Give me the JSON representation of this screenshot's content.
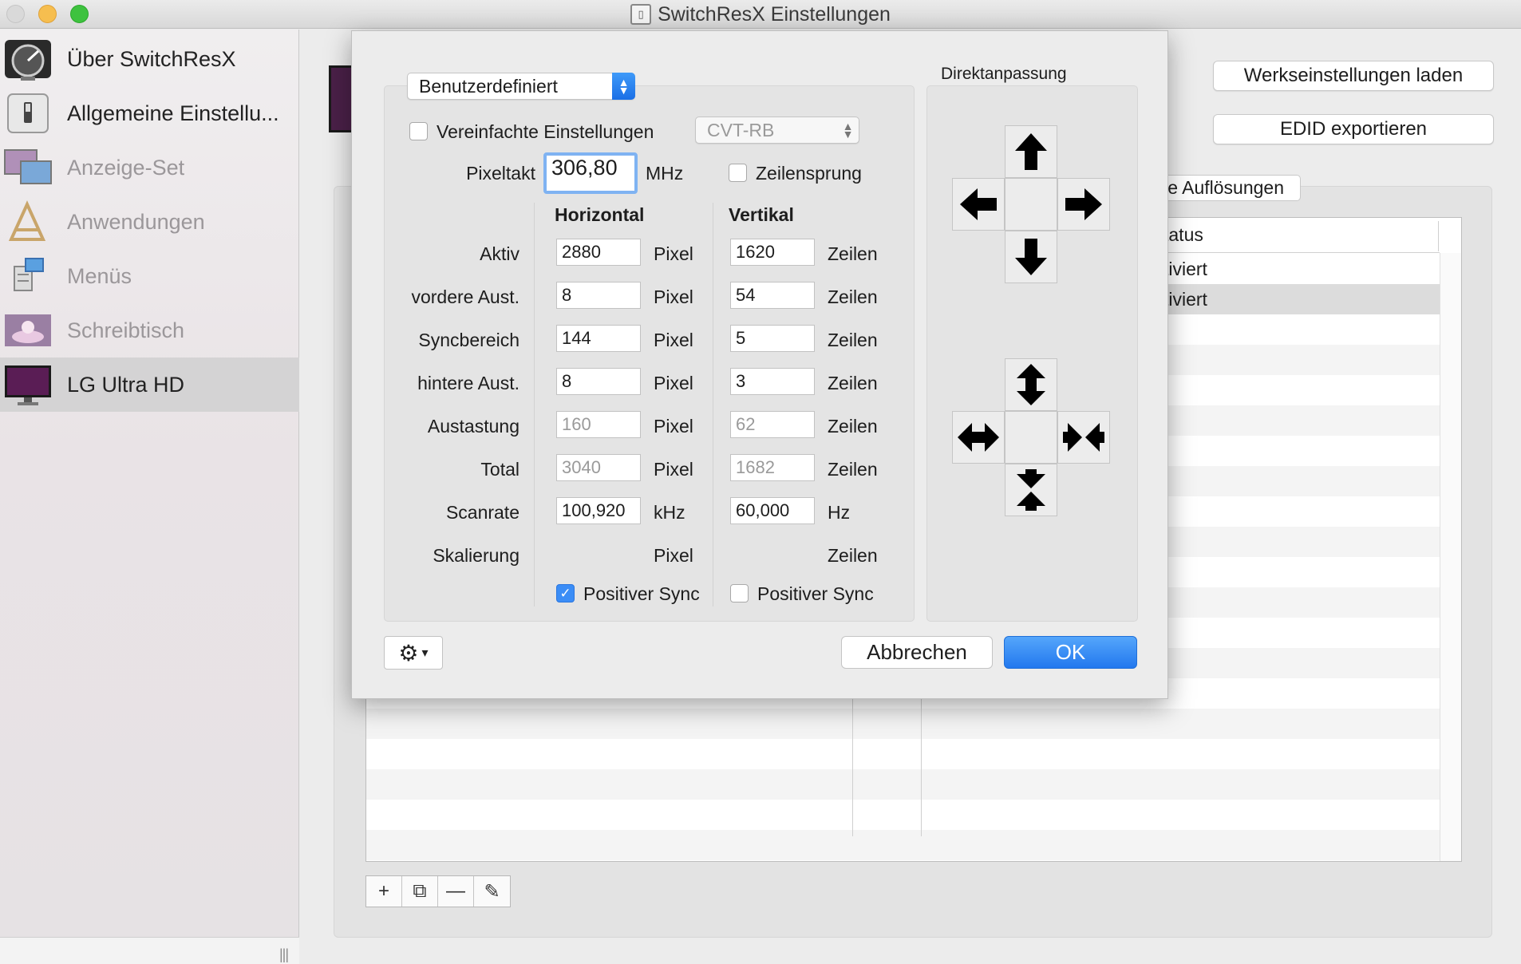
{
  "window": {
    "title": "SwitchResX Einstellungen"
  },
  "sidebar": {
    "items": [
      {
        "label": "Über SwitchResX",
        "enabled": true,
        "selected": false,
        "icon": "gauge-icon"
      },
      {
        "label": "Allgemeine Einstellu...",
        "enabled": true,
        "selected": false,
        "icon": "switch-icon"
      },
      {
        "label": "Anzeige-Set",
        "enabled": false,
        "selected": false,
        "icon": "displays-icon"
      },
      {
        "label": "Anwendungen",
        "enabled": false,
        "selected": false,
        "icon": "applications-icon"
      },
      {
        "label": "Menüs",
        "enabled": false,
        "selected": false,
        "icon": "menus-icon"
      },
      {
        "label": "Schreibtisch",
        "enabled": false,
        "selected": false,
        "icon": "desktop-icon"
      },
      {
        "label": "LG Ultra HD",
        "enabled": true,
        "selected": true,
        "icon": "monitor-icon"
      }
    ]
  },
  "main": {
    "factory_button": "Werkseinstellungen laden",
    "edid_button": "EDID exportieren",
    "tab_label": "e Auflösungen",
    "table": {
      "status_header": "tatus",
      "rows": [
        "tiviert",
        "tiviert"
      ]
    },
    "tools": {
      "add": "+",
      "duplicate": "⧉",
      "remove": "—",
      "edit": "✎"
    }
  },
  "dialog": {
    "preset": "Benutzerdefiniert",
    "simplified_label": "Vereinfachte Einstellungen",
    "simplified_checked": false,
    "timing_mode": "CVT-RB",
    "pixelclock_label": "Pixeltakt",
    "pixelclock_value": "306,80",
    "pixelclock_unit": "MHz",
    "interlace_label": "Zeilensprung",
    "interlace_checked": false,
    "col_horizontal": "Horizontal",
    "col_vertical": "Vertikal",
    "rows": [
      {
        "label": "Aktiv",
        "h": "2880",
        "h_unit": "Pixel",
        "v": "1620",
        "v_unit": "Zeilen",
        "editable": true
      },
      {
        "label": "vordere Aust.",
        "h": "8",
        "h_unit": "Pixel",
        "v": "54",
        "v_unit": "Zeilen",
        "editable": true
      },
      {
        "label": "Syncbereich",
        "h": "144",
        "h_unit": "Pixel",
        "v": "5",
        "v_unit": "Zeilen",
        "editable": true
      },
      {
        "label": "hintere Aust.",
        "h": "8",
        "h_unit": "Pixel",
        "v": "3",
        "v_unit": "Zeilen",
        "editable": true
      },
      {
        "label": "Austastung",
        "h": "160",
        "h_unit": "Pixel",
        "v": "62",
        "v_unit": "Zeilen",
        "editable": false
      },
      {
        "label": "Total",
        "h": "3040",
        "h_unit": "Pixel",
        "v": "1682",
        "v_unit": "Zeilen",
        "editable": false
      },
      {
        "label": "Scanrate",
        "h": "100,920",
        "h_unit": "kHz",
        "v": "60,000",
        "v_unit": "Hz",
        "editable": true
      }
    ],
    "scaling": {
      "label": "Skalierung",
      "h_unit": "Pixel",
      "v_unit": "Zeilen"
    },
    "h_sync_label": "Positiver Sync",
    "h_sync_checked": true,
    "v_sync_label": "Positiver Sync",
    "v_sync_checked": false,
    "direct_title": "Direktanpassung",
    "cancel_button": "Abbrechen",
    "ok_button": "OK"
  },
  "colors": {
    "accent": "#2b7ff0",
    "selection": "#d4d3d4",
    "window_bg": "#ececec"
  }
}
